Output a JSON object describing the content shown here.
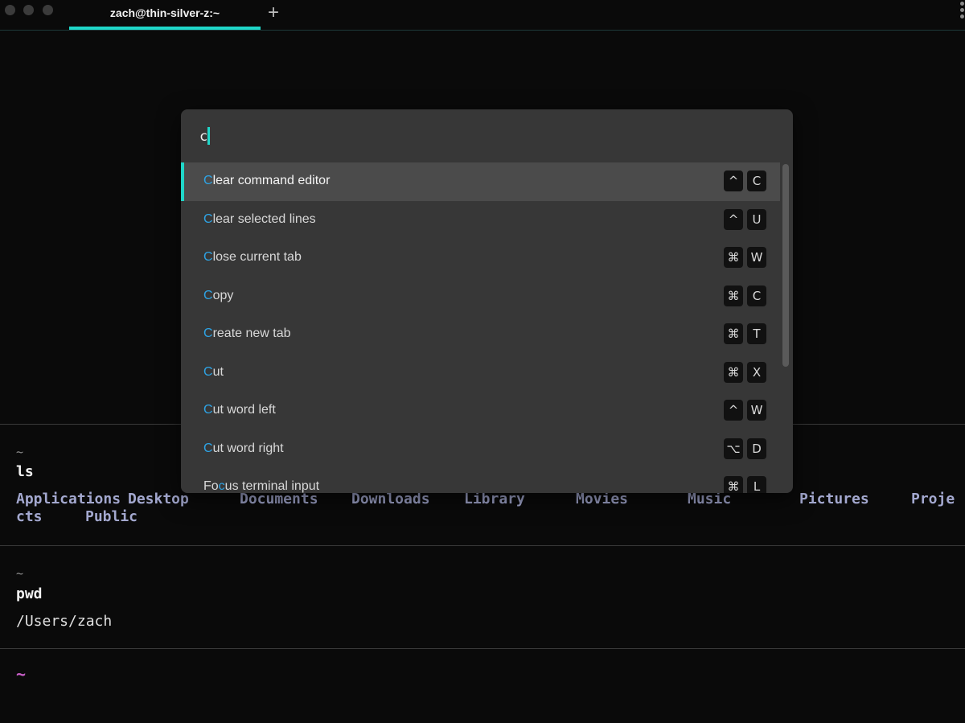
{
  "window": {
    "tab_title": "zach@thin-silver-z:~",
    "new_tab_label": "+"
  },
  "palette": {
    "query": "c",
    "items": [
      {
        "pre": "",
        "hl": "C",
        "post": "lear command editor",
        "keys": [
          "^",
          "C"
        ],
        "selected": true
      },
      {
        "pre": "",
        "hl": "C",
        "post": "lear selected lines",
        "keys": [
          "^",
          "U"
        ]
      },
      {
        "pre": "",
        "hl": "C",
        "post": "lose current tab",
        "keys": [
          "⌘",
          "W"
        ]
      },
      {
        "pre": "",
        "hl": "C",
        "post": "opy",
        "keys": [
          "⌘",
          "C"
        ]
      },
      {
        "pre": "",
        "hl": "C",
        "post": "reate new tab",
        "keys": [
          "⌘",
          "T"
        ]
      },
      {
        "pre": "",
        "hl": "C",
        "post": "ut",
        "keys": [
          "⌘",
          "X"
        ]
      },
      {
        "pre": "",
        "hl": "C",
        "post": "ut word left",
        "keys": [
          "^",
          "W"
        ]
      },
      {
        "pre": "",
        "hl": "C",
        "post": "ut word right",
        "keys": [
          "⌥",
          "D"
        ]
      },
      {
        "pre": "Fo",
        "hl": "c",
        "post": "us terminal input",
        "keys": [
          "⌘",
          "L"
        ]
      }
    ]
  },
  "terminal": {
    "blocks": [
      {
        "dir": "~",
        "command": "ls",
        "output_row1": [
          "Applications",
          "Desktop",
          "Documents",
          "Downloads",
          "Library",
          "Movies",
          "Music",
          "Pictures",
          "Proje"
        ],
        "output_row2": [
          "cts",
          "Public"
        ]
      },
      {
        "dir": "~",
        "command": "pwd",
        "output": "/Users/zach"
      }
    ],
    "active_prompt": "~"
  },
  "colors": {
    "accent": "#1fd7c9",
    "match_highlight": "#2ea4e6",
    "ls_output": "#a3a8cf",
    "prompt": "#c95fc8"
  }
}
